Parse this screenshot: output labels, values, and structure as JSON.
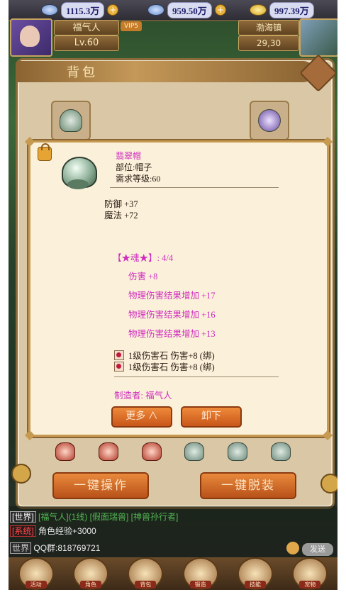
{
  "top_bar": {
    "resource_1": "1115.3万",
    "resource_2": "959.50万",
    "resource_3": "997.39万"
  },
  "player": {
    "name": "福气人",
    "level": "Lv.60",
    "vip": "VIP5",
    "location": "渤海镇",
    "coords": "29,30"
  },
  "bag": {
    "title": "背包",
    "btn_batch": "一键操作",
    "btn_unequip_all": "一键脱装"
  },
  "tooltip": {
    "name": "翡翠帽",
    "slot": "部位:帽子",
    "req_level": "需求等级:60",
    "stats": [
      "防御 +37",
      "魔法 +72"
    ],
    "soul_title": "【★魂★】: 4/4",
    "soul_lines": [
      "伤害 +8",
      "物理伤害结果增加 +17",
      "物理伤害结果增加 +16",
      "物理伤害结果增加 +13"
    ],
    "gems": [
      "1级伤害石   伤害+8  (绑)",
      "1级伤害石   伤害+8  (绑)"
    ],
    "maker": "制造者: 福气人",
    "btn_more": "更多 ∧",
    "btn_unequip": "卸下"
  },
  "chat": {
    "line1_tag": "[世界]",
    "line1_text": "[福气人](1线) [假面瑞兽] [神兽孙行者]",
    "line2_tag": "[系统]",
    "line2_text": "角色经验+3000",
    "line3_tag": "世界",
    "line3_text": "QQ群:818769721",
    "send": "发送"
  },
  "bottom_nav": [
    "活动",
    "角色",
    "背包",
    "锻造",
    "技能",
    "宠物"
  ]
}
